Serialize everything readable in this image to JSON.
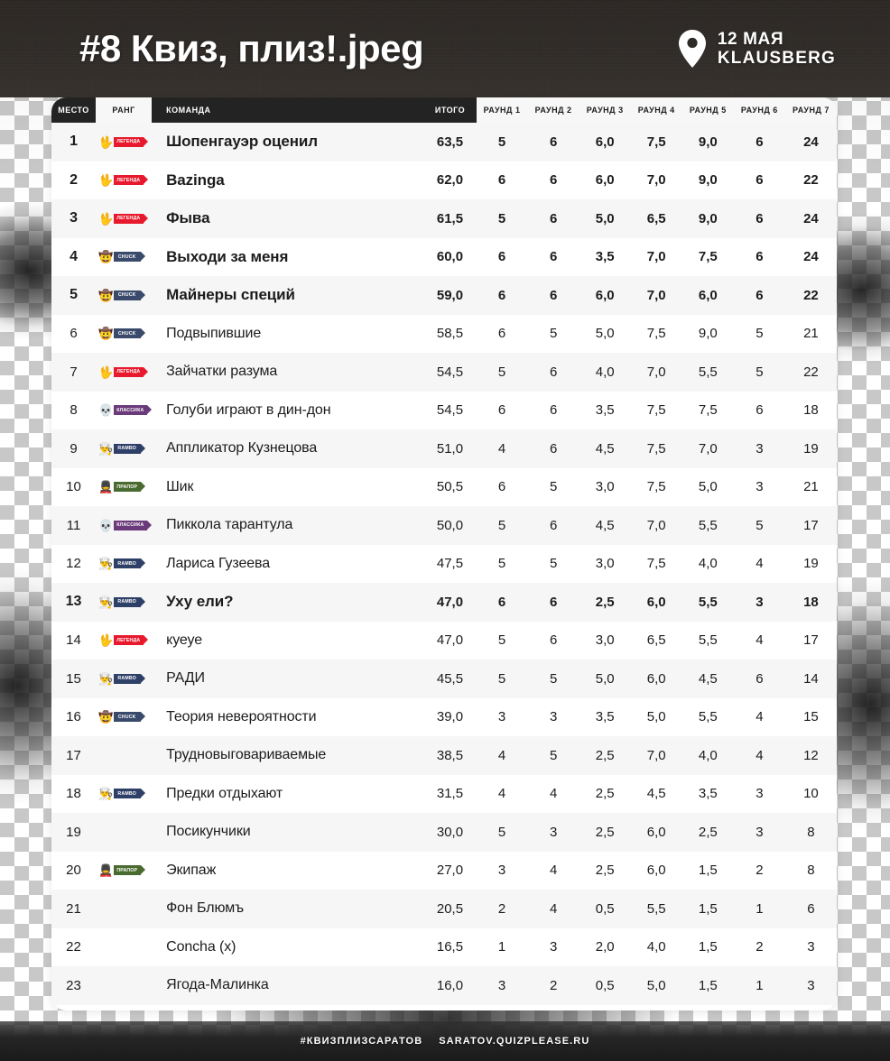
{
  "header": {
    "title": "#8 Квиз, плиз!.jpeg",
    "pin_icon": "location-pin-icon",
    "venue_date": "12 МАЯ",
    "venue_name": "KLAUSBERG"
  },
  "table": {
    "columns": {
      "place": "МЕСТО",
      "rank": "РАНГ",
      "team": "КОМАНДА",
      "total": "ИТОГО",
      "rounds": [
        "РАУНД 1",
        "РАУНД 2",
        "РАУНД 3",
        "РАУНД 4",
        "РАУНД 5",
        "РАУНД 6",
        "РАУНД 7"
      ]
    },
    "rows": [
      {
        "place": "1",
        "badge": {
          "label": "ЛЕГЕНДА",
          "emoji": "🖖",
          "color": "#e8192c"
        },
        "team": "Шопенгауэр оценил",
        "total": "63,5",
        "rounds": [
          "5",
          "6",
          "6,0",
          "7,5",
          "9,0",
          "6",
          "24"
        ],
        "highlight": true
      },
      {
        "place": "2",
        "badge": {
          "label": "ЛЕГЕНДА",
          "emoji": "🖖",
          "color": "#e8192c"
        },
        "team": "Bazinga",
        "total": "62,0",
        "rounds": [
          "6",
          "6",
          "6,0",
          "7,0",
          "9,0",
          "6",
          "22"
        ],
        "highlight": true
      },
      {
        "place": "3",
        "badge": {
          "label": "ЛЕГЕНДА",
          "emoji": "🖖",
          "color": "#e8192c"
        },
        "team": "Фыва",
        "total": "61,5",
        "rounds": [
          "5",
          "6",
          "5,0",
          "6,5",
          "9,0",
          "6",
          "24"
        ],
        "highlight": true
      },
      {
        "place": "4",
        "badge": {
          "label": "CHUCK",
          "emoji": "🤠",
          "color": "#3a4a6b"
        },
        "team": "Выходи за меня",
        "total": "60,0",
        "rounds": [
          "6",
          "6",
          "3,5",
          "7,0",
          "7,5",
          "6",
          "24"
        ],
        "highlight": true
      },
      {
        "place": "5",
        "badge": {
          "label": "CHUCK",
          "emoji": "🤠",
          "color": "#3a4a6b"
        },
        "team": "Майнеры специй",
        "total": "59,0",
        "rounds": [
          "6",
          "6",
          "6,0",
          "7,0",
          "6,0",
          "6",
          "22"
        ],
        "highlight": true
      },
      {
        "place": "6",
        "badge": {
          "label": "CHUCK",
          "emoji": "🤠",
          "color": "#3a4a6b"
        },
        "team": "Подвыпившие",
        "total": "58,5",
        "rounds": [
          "6",
          "5",
          "5,0",
          "7,5",
          "9,0",
          "5",
          "21"
        ],
        "highlight": false
      },
      {
        "place": "7",
        "badge": {
          "label": "ЛЕГЕНДА",
          "emoji": "🖖",
          "color": "#e8192c"
        },
        "team": "Зайчатки разума",
        "total": "54,5",
        "rounds": [
          "5",
          "6",
          "4,0",
          "7,0",
          "5,5",
          "5",
          "22"
        ],
        "highlight": false
      },
      {
        "place": "8",
        "badge": {
          "label": "КЛАССИКА",
          "emoji": "💀",
          "color": "#6b3a7a"
        },
        "team": "Голуби играют в дин-дон",
        "total": "54,5",
        "rounds": [
          "6",
          "6",
          "3,5",
          "7,5",
          "7,5",
          "6",
          "18"
        ],
        "highlight": false
      },
      {
        "place": "9",
        "badge": {
          "label": "RAMBO",
          "emoji": "👨‍🍳",
          "color": "#2f4068"
        },
        "team": "Аппликатор Кузнецова",
        "total": "51,0",
        "rounds": [
          "4",
          "6",
          "4,5",
          "7,5",
          "7,0",
          "3",
          "19"
        ],
        "highlight": false
      },
      {
        "place": "10",
        "badge": {
          "label": "ПРАПОР",
          "emoji": "💂",
          "color": "#4a6b2f"
        },
        "team": "Шик",
        "total": "50,5",
        "rounds": [
          "6",
          "5",
          "3,0",
          "7,5",
          "5,0",
          "3",
          "21"
        ],
        "highlight": false
      },
      {
        "place": "11",
        "badge": {
          "label": "КЛАССИКА",
          "emoji": "💀",
          "color": "#6b3a7a"
        },
        "team": "Пиккола тарантула",
        "total": "50,0",
        "rounds": [
          "5",
          "6",
          "4,5",
          "7,0",
          "5,5",
          "5",
          "17"
        ],
        "highlight": false
      },
      {
        "place": "12",
        "badge": {
          "label": "RAMBO",
          "emoji": "👨‍🍳",
          "color": "#2f4068"
        },
        "team": "Лариса Гузеева",
        "total": "47,5",
        "rounds": [
          "5",
          "5",
          "3,0",
          "7,5",
          "4,0",
          "4",
          "19"
        ],
        "highlight": false
      },
      {
        "place": "13",
        "badge": {
          "label": "RAMBO",
          "emoji": "👨‍🍳",
          "color": "#2f4068"
        },
        "team": "Уху ели?",
        "total": "47,0",
        "rounds": [
          "6",
          "6",
          "2,5",
          "6,0",
          "5,5",
          "3",
          "18"
        ],
        "highlight": true
      },
      {
        "place": "14",
        "badge": {
          "label": "ЛЕГЕНДА",
          "emoji": "🖖",
          "color": "#e8192c"
        },
        "team": "куеуе",
        "total": "47,0",
        "rounds": [
          "5",
          "6",
          "3,0",
          "6,5",
          "5,5",
          "4",
          "17"
        ],
        "highlight": false
      },
      {
        "place": "15",
        "badge": {
          "label": "RAMBO",
          "emoji": "👨‍🍳",
          "color": "#2f4068"
        },
        "team": "РАДИ",
        "total": "45,5",
        "rounds": [
          "5",
          "5",
          "5,0",
          "6,0",
          "4,5",
          "6",
          "14"
        ],
        "highlight": false
      },
      {
        "place": "16",
        "badge": {
          "label": "CHUCK",
          "emoji": "🤠",
          "color": "#3a4a6b"
        },
        "team": "Теория невероятности",
        "total": "39,0",
        "rounds": [
          "3",
          "3",
          "3,5",
          "5,0",
          "5,5",
          "4",
          "15"
        ],
        "highlight": false
      },
      {
        "place": "17",
        "badge": null,
        "team": "Трудновыговариваемые",
        "total": "38,5",
        "rounds": [
          "4",
          "5",
          "2,5",
          "7,0",
          "4,0",
          "4",
          "12"
        ],
        "highlight": false
      },
      {
        "place": "18",
        "badge": {
          "label": "RAMBO",
          "emoji": "👨‍🍳",
          "color": "#2f4068"
        },
        "team": "Предки отдыхают",
        "total": "31,5",
        "rounds": [
          "4",
          "4",
          "2,5",
          "4,5",
          "3,5",
          "3",
          "10"
        ],
        "highlight": false
      },
      {
        "place": "19",
        "badge": null,
        "team": "Посикунчики",
        "total": "30,0",
        "rounds": [
          "5",
          "3",
          "2,5",
          "6,0",
          "2,5",
          "3",
          "8"
        ],
        "highlight": false
      },
      {
        "place": "20",
        "badge": {
          "label": "ПРАПОР",
          "emoji": "💂",
          "color": "#4a6b2f"
        },
        "team": "Экипаж",
        "total": "27,0",
        "rounds": [
          "3",
          "4",
          "2,5",
          "6,0",
          "1,5",
          "2",
          "8"
        ],
        "highlight": false
      },
      {
        "place": "21",
        "badge": null,
        "team": "Фон Блюмъ",
        "total": "20,5",
        "rounds": [
          "2",
          "4",
          "0,5",
          "5,5",
          "1,5",
          "1",
          "6"
        ],
        "highlight": false
      },
      {
        "place": "22",
        "badge": null,
        "team": "Concha (x)",
        "total": "16,5",
        "rounds": [
          "1",
          "3",
          "2,0",
          "4,0",
          "1,5",
          "2",
          "3"
        ],
        "highlight": false
      },
      {
        "place": "23",
        "badge": null,
        "team": "Ягода-Малинка",
        "total": "16,0",
        "rounds": [
          "3",
          "2",
          "0,5",
          "5,0",
          "1,5",
          "1",
          "3"
        ],
        "highlight": false
      }
    ]
  },
  "footer": {
    "hashtag": "#КВИЗПЛИЗСАРАТОВ",
    "site": "SARATOV.QUIZPLEASE.RU"
  },
  "colors": {
    "header_dark": "#232323",
    "card_bg": "#ffffff",
    "row_odd": "#f6f6f6",
    "row_even": "#ffffff",
    "text": "#1c1c1c"
  }
}
